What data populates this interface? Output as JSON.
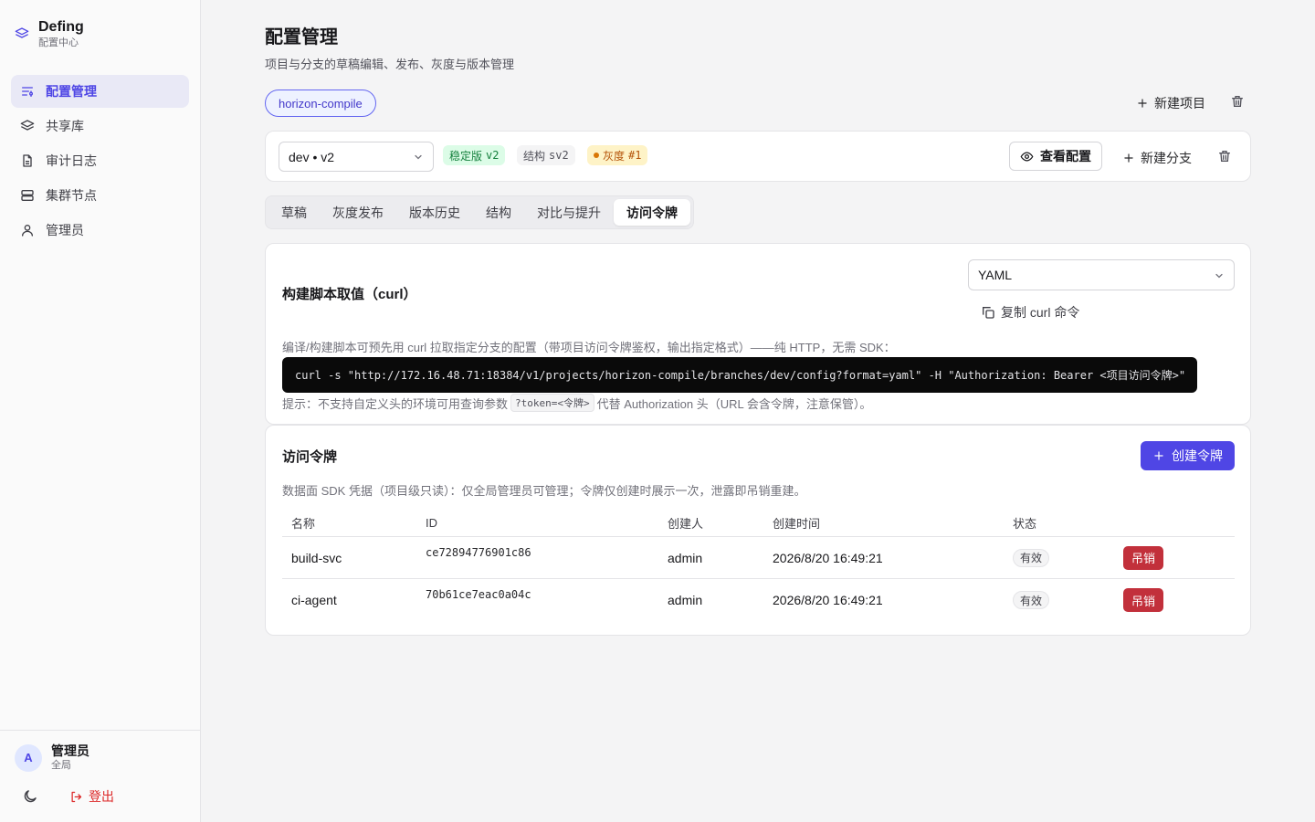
{
  "brand": {
    "title": "Defing",
    "subtitle": "配置中心"
  },
  "sidebar": {
    "items": [
      {
        "label": "配置管理",
        "icon": "config-icon",
        "active": true
      },
      {
        "label": "共享库",
        "icon": "layers-icon"
      },
      {
        "label": "审计日志",
        "icon": "document-icon"
      },
      {
        "label": "集群节点",
        "icon": "server-icon"
      },
      {
        "label": "管理员",
        "icon": "user-icon"
      }
    ]
  },
  "user": {
    "avatar": "A",
    "name": "管理员",
    "role": "全局"
  },
  "footer": {
    "logout": "登出"
  },
  "page": {
    "title": "配置管理",
    "subtitle": "项目与分支的草稿编辑、发布、灰度与版本管理"
  },
  "project": {
    "name": "horizon-compile",
    "new_project": "新建项目"
  },
  "branch": {
    "selected": "dev • v2",
    "badges": {
      "stable_label": "稳定版",
      "stable_value": "v2",
      "schema_label": "结构",
      "schema_value": "sv2",
      "gray_label": "灰度",
      "gray_value": "#1"
    },
    "view_config": "查看配置",
    "new_branch": "新建分支"
  },
  "tabs": [
    "草稿",
    "灰度发布",
    "版本历史",
    "结构",
    "对比与提升",
    "访问令牌"
  ],
  "active_tab": "访问令牌",
  "curl_card": {
    "title": "构建脚本取值（curl）",
    "format": "YAML",
    "copy": "复制 curl 命令",
    "desc": "编译/构建脚本可预先用 curl 拉取指定分支的配置（带项目访问令牌鉴权，输出指定格式）——纯 HTTP，无需 SDK：",
    "command": "curl -s \"http://172.16.48.71:18384/v1/projects/horizon-compile/branches/dev/config?format=yaml\" -H \"Authorization: Bearer <项目访问令牌>\"",
    "hint_before": "提示：不支持自定义头的环境可用查询参数",
    "hint_code": "?token=<令牌>",
    "hint_after": "代替 Authorization 头（URL 会含令牌，注意保管）。"
  },
  "tokens_card": {
    "title": "访问令牌",
    "create": "创建令牌",
    "desc": "数据面 SDK 凭据（项目级只读）：仅全局管理员可管理；令牌仅创建时展示一次，泄露即吊销重建。",
    "columns": [
      "名称",
      "ID",
      "创建人",
      "创建时间",
      "状态"
    ],
    "rows": [
      {
        "name": "build-svc",
        "id": "ce72894776901c86",
        "creator": "admin",
        "created": "2026/8/20 16:49:21",
        "status": "有效",
        "action": "吊销"
      },
      {
        "name": "ci-agent",
        "id": "70b61ce7eac0a04c",
        "creator": "admin",
        "created": "2026/8/20 16:49:21",
        "status": "有效",
        "action": "吊销"
      }
    ]
  },
  "colors": {
    "accent": "#4f46e5",
    "danger": "#c2303b",
    "stable": "#15803d",
    "gray": "#b45309"
  }
}
